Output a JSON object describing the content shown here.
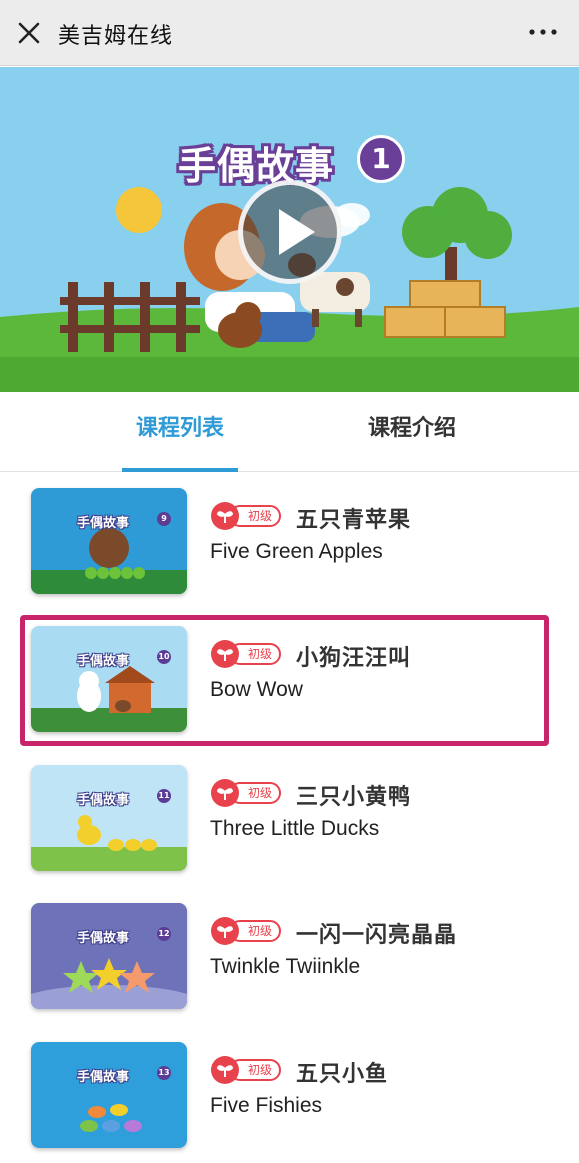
{
  "nav": {
    "title": "美吉姆在线",
    "close_icon": "close-icon",
    "more_icon": "more-icon"
  },
  "hero": {
    "title": "手偶故事",
    "badge_number": "1",
    "play_icon": "play-icon",
    "colors": {
      "sky": "#89cfee",
      "grass": "#5cb83a",
      "title_outline": "#6a3f97"
    }
  },
  "tabs": [
    {
      "label": "课程列表",
      "active": true
    },
    {
      "label": "课程介绍",
      "active": false
    }
  ],
  "courses": [
    {
      "thumb_label": "手偶故事",
      "thumb_number": "9",
      "level": "初级",
      "title_cn": "五只青苹果",
      "title_en": "Five Green Apples",
      "highlighted": false
    },
    {
      "thumb_label": "手偶故事",
      "thumb_number": "10",
      "level": "初级",
      "title_cn": "小狗汪汪叫",
      "title_en": "Bow Wow",
      "highlighted": true
    },
    {
      "thumb_label": "手偶故事",
      "thumb_number": "11",
      "level": "初级",
      "title_cn": "三只小黄鸭",
      "title_en": "Three Little Ducks",
      "highlighted": false
    },
    {
      "thumb_label": "手偶故事",
      "thumb_number": "12",
      "level": "初级",
      "title_cn": "一闪一闪亮晶晶",
      "title_en": "Twinkle Twiinkle",
      "highlighted": false
    },
    {
      "thumb_label": "手偶故事",
      "thumb_number": "13",
      "level": "初级",
      "title_cn": "五只小鱼",
      "title_en": "Five Fishies",
      "highlighted": false
    }
  ],
  "colors": {
    "accent": "#2f9bd6",
    "highlight": "#c8246a",
    "level_badge": "#e8434c"
  }
}
